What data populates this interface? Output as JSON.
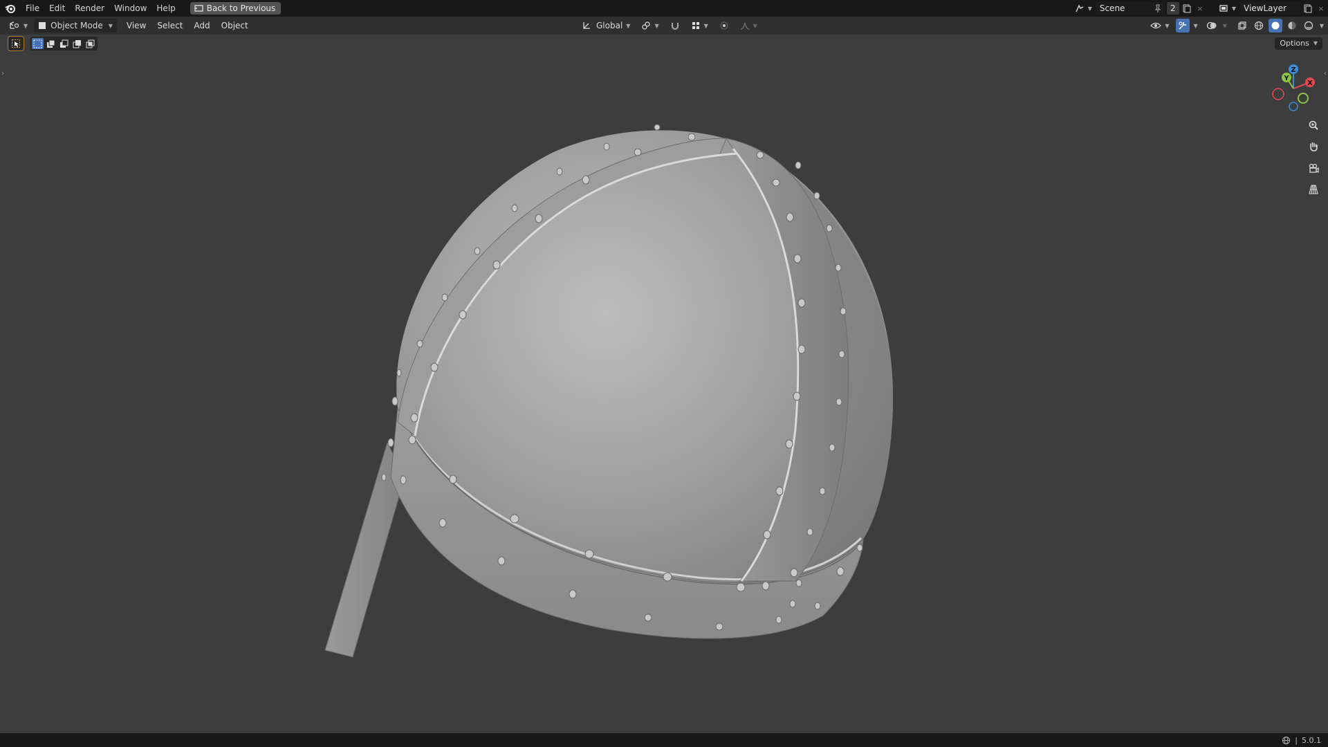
{
  "topbar": {
    "menu": [
      "File",
      "Edit",
      "Render",
      "Window",
      "Help"
    ],
    "back_button": "Back to Previous",
    "scene_name": "Scene",
    "scene_users": "2",
    "view_layer": "ViewLayer"
  },
  "viewport_header": {
    "mode": "Object Mode",
    "menus": [
      "View",
      "Select",
      "Add",
      "Object"
    ],
    "transform_orientation": "Global",
    "options_label": "Options"
  },
  "gizmo": {
    "x_label": "X",
    "y_label": "Y",
    "z_label": "Z"
  },
  "colors": {
    "accent": "#4772b3",
    "axis_x": "#e34a52",
    "axis_y": "#8bc541",
    "axis_z": "#3d8fdb",
    "viewport_bg": "#3d3d3d"
  },
  "statusbar": {
    "version": "5.0.1"
  }
}
